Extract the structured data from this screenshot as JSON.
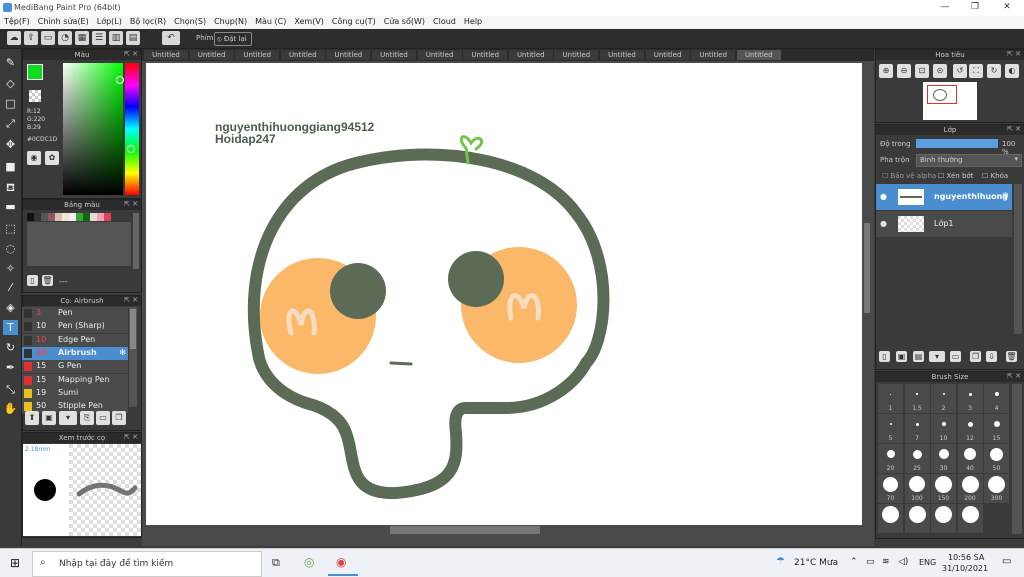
{
  "window": {
    "title": "MediBang Paint Pro (64bit)"
  },
  "menu": [
    "Tệp(F)",
    "Chỉnh sửa(E)",
    "Lớp(L)",
    "Bộ lọc(R)",
    "Chọn(S)",
    "Chụp(N)",
    "Màu (C)",
    "Xem(V)",
    "Công cụ(T)",
    "Cửa sổ(W)",
    "Cloud",
    "Help"
  ],
  "toolbar": {
    "phim_label": "Phím",
    "reset_label": "Đặt lại"
  },
  "color_panel": {
    "title": "Màu",
    "r": "R:12",
    "g": "G:220",
    "b": "B:29",
    "hex": "#0CDC1D",
    "foreground": "#0cdc1d"
  },
  "palette_panel": {
    "title": "Bảng màu",
    "more": "---",
    "swatches": [
      "#111111",
      "#333333",
      "#555555",
      "#8b5a5a",
      "#d8c0b0",
      "#f0e6d8",
      "#f8f0e8",
      "#33aa33",
      "#116611",
      "#e8d8d8",
      "#f0a0b0",
      "#e04060"
    ]
  },
  "brush_panel": {
    "title": "Cọ: Airbrush",
    "items": [
      {
        "size": "3",
        "name": "Pen",
        "color": "#333333"
      },
      {
        "size": "10",
        "name": "Pen (Sharp)",
        "color": "#333333"
      },
      {
        "size": "10",
        "name": "Edge Pen",
        "color": "#333333"
      },
      {
        "size": "30",
        "name": "Airbrush",
        "color": "#333333"
      },
      {
        "size": "15",
        "name": "G Pen",
        "color": "#e03030"
      },
      {
        "size": "15",
        "name": "Mapping Pen",
        "color": "#e03030"
      },
      {
        "size": "19",
        "name": "Sumi",
        "color": "#e8c020"
      },
      {
        "size": "50",
        "name": "Stipple Pen",
        "color": "#e8c020"
      }
    ]
  },
  "preview_panel": {
    "title": "Xem trước cọ",
    "size": "2.18mm"
  },
  "tabs": [
    "Untitled",
    "Untitled",
    "Untitled",
    "Untitled",
    "Untitled",
    "Untitled",
    "Untitled",
    "Untitled",
    "Untitled",
    "Untitled",
    "Untitled",
    "Untitled",
    "Untitled",
    "Untitled"
  ],
  "canvas": {
    "watermark_line1": "nguyenthihuonggiang94512",
    "watermark_line2": "Hoidap247"
  },
  "navigator_panel": {
    "title": "Hoa tiêu"
  },
  "layer_panel": {
    "title": "Lớp",
    "opacity_label": "Độ trong",
    "opacity_value": "100 %",
    "opacity_fraction": 1.0,
    "blend_label": "Pha trộn",
    "blend_value": "Bình thường",
    "protect_alpha": "Bảo vệ alpha",
    "clip": "Xén bớt",
    "lock": "Khóa",
    "layers": [
      {
        "name": "nguyenthihuong",
        "selected": true
      },
      {
        "name": "Lớp1",
        "selected": false
      }
    ]
  },
  "brush_size_panel": {
    "title": "Brush Size",
    "sizes": [
      "1",
      "1.5",
      "2",
      "3",
      "4",
      "5",
      "7",
      "10",
      "12",
      "15",
      "20",
      "25",
      "30",
      "40",
      "50",
      "70",
      "100",
      "150",
      "200",
      "300",
      "",
      "",
      "",
      ""
    ]
  },
  "taskbar": {
    "search_placeholder": "Nhập tại đây để tìm kiếm",
    "weather": "21°C Mưa",
    "lang": "ENG",
    "time": "10:56 SA",
    "date": "31/10/2021"
  }
}
